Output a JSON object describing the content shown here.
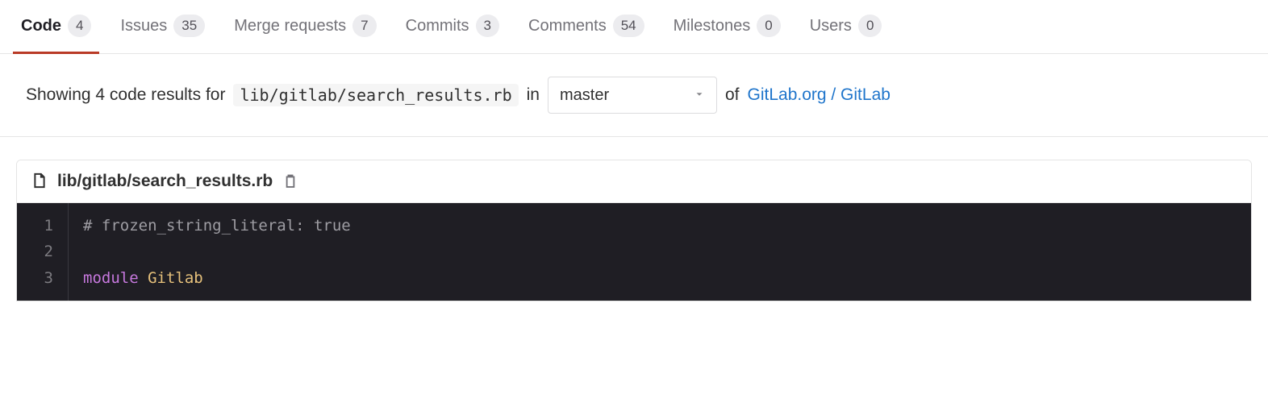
{
  "tabs": [
    {
      "label": "Code",
      "count": "4",
      "active": true
    },
    {
      "label": "Issues",
      "count": "35",
      "active": false
    },
    {
      "label": "Merge requests",
      "count": "7",
      "active": false
    },
    {
      "label": "Commits",
      "count": "3",
      "active": false
    },
    {
      "label": "Comments",
      "count": "54",
      "active": false
    },
    {
      "label": "Milestones",
      "count": "0",
      "active": false
    },
    {
      "label": "Users",
      "count": "0",
      "active": false
    }
  ],
  "results": {
    "prefix": "Showing 4 code results for",
    "query": "lib/gitlab/search_results.rb",
    "in_word": "in",
    "branch": "master",
    "of_word": "of",
    "project_link": "GitLab.org / GitLab"
  },
  "file": {
    "path": "lib/gitlab/search_results.rb",
    "lines": [
      {
        "n": "1",
        "tokens": [
          {
            "t": "# frozen_string_literal: true",
            "c": "tok-comment"
          }
        ]
      },
      {
        "n": "2",
        "tokens": []
      },
      {
        "n": "3",
        "tokens": [
          {
            "t": "module",
            "c": "tok-keyword"
          },
          {
            "t": " ",
            "c": ""
          },
          {
            "t": "Gitlab",
            "c": "tok-const"
          }
        ]
      }
    ]
  }
}
